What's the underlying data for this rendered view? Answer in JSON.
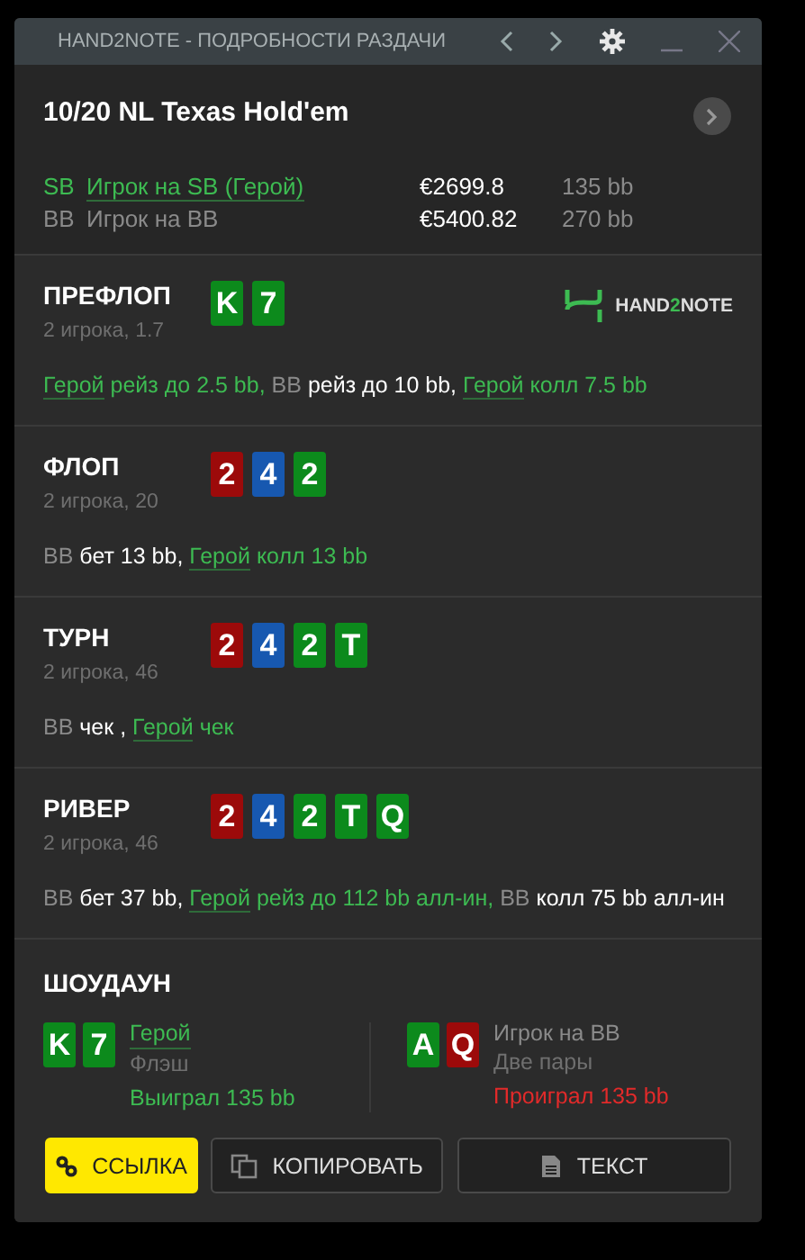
{
  "window": {
    "title": "HAND2NOTE - ПОДРОБНОСТИ РАЗДАЧИ"
  },
  "hand": {
    "title": "10/20 NL Texas Hold'em"
  },
  "players": [
    {
      "position": "SB",
      "name": "Игрок на SB (Герой)",
      "hero": true,
      "stack": "€2699.8",
      "bb": "135 bb"
    },
    {
      "position": "BB",
      "name": "Игрок на BB",
      "hero": false,
      "stack": "€5400.82",
      "bb": "270 bb"
    }
  ],
  "logo": {
    "before": "HAND",
    "accent": "2",
    "after": "NOTE"
  },
  "streets": [
    {
      "name": "ПРЕФЛОП",
      "info": "2 игрока, 1.7",
      "logo": true,
      "cards": [
        {
          "rank": "K",
          "color": "#0c8a1c"
        },
        {
          "rank": "7",
          "color": "#0c8a1c"
        }
      ],
      "actions": [
        {
          "actor": "Герой",
          "hero": true,
          "text": "рейз до 2.5 bb,"
        },
        {
          "actor": "BB",
          "hero": false,
          "text": "рейз до 10 bb,"
        },
        {
          "actor": "Герой",
          "hero": true,
          "text": "колл 7.5 bb"
        }
      ]
    },
    {
      "name": "ФЛОП",
      "info": "2 игрока, 20",
      "logo": false,
      "cards": [
        {
          "rank": "2",
          "color": "#9c0a0a"
        },
        {
          "rank": "4",
          "color": "#1758b0"
        },
        {
          "rank": "2",
          "color": "#0c8a1c"
        }
      ],
      "actions": [
        {
          "actor": "BB",
          "hero": false,
          "text": "бет 13 bb,"
        },
        {
          "actor": "Герой",
          "hero": true,
          "text": "колл 13 bb"
        }
      ]
    },
    {
      "name": "ТУРН",
      "info": "2 игрока, 46",
      "logo": false,
      "cards": [
        {
          "rank": "2",
          "color": "#9c0a0a"
        },
        {
          "rank": "4",
          "color": "#1758b0"
        },
        {
          "rank": "2",
          "color": "#0c8a1c"
        },
        {
          "rank": "T",
          "color": "#0c8a1c"
        }
      ],
      "actions": [
        {
          "actor": "BB",
          "hero": false,
          "text": "чек ,"
        },
        {
          "actor": "Герой",
          "hero": true,
          "text": "чек"
        }
      ]
    },
    {
      "name": "РИВЕР",
      "info": "2 игрока, 46",
      "logo": false,
      "cards": [
        {
          "rank": "2",
          "color": "#9c0a0a"
        },
        {
          "rank": "4",
          "color": "#1758b0"
        },
        {
          "rank": "2",
          "color": "#0c8a1c"
        },
        {
          "rank": "T",
          "color": "#0c8a1c"
        },
        {
          "rank": "Q",
          "color": "#0c8a1c"
        }
      ],
      "actions": [
        {
          "actor": "BB",
          "hero": false,
          "text": "бет 37 bb,"
        },
        {
          "actor": "Герой",
          "hero": true,
          "text": "рейз до 112 bb алл-ин,"
        },
        {
          "actor": "BB",
          "hero": false,
          "text": "колл 75 bb алл-ин"
        }
      ]
    }
  ],
  "showdown": {
    "title": "ШОУДАУН",
    "players": [
      {
        "name": "Герой",
        "hero": true,
        "hand": "Флэш",
        "result": "Выиграл 135 bb",
        "won": true,
        "cards": [
          {
            "rank": "K",
            "color": "#0c8a1c"
          },
          {
            "rank": "7",
            "color": "#0c8a1c"
          }
        ]
      },
      {
        "name": "Игрок на BB",
        "hero": false,
        "hand": "Две пары",
        "result": "Проиграл 135 bb",
        "won": false,
        "cards": [
          {
            "rank": "A",
            "color": "#0c8a1c"
          },
          {
            "rank": "Q",
            "color": "#9c0a0a"
          }
        ]
      }
    ]
  },
  "buttons": [
    {
      "kind": "link",
      "label": "ССЫЛКА",
      "primary": true
    },
    {
      "kind": "copy",
      "label": "КОПИРОВАТЬ",
      "primary": false
    },
    {
      "kind": "text",
      "label": "ТЕКСТ",
      "primary": false
    }
  ]
}
